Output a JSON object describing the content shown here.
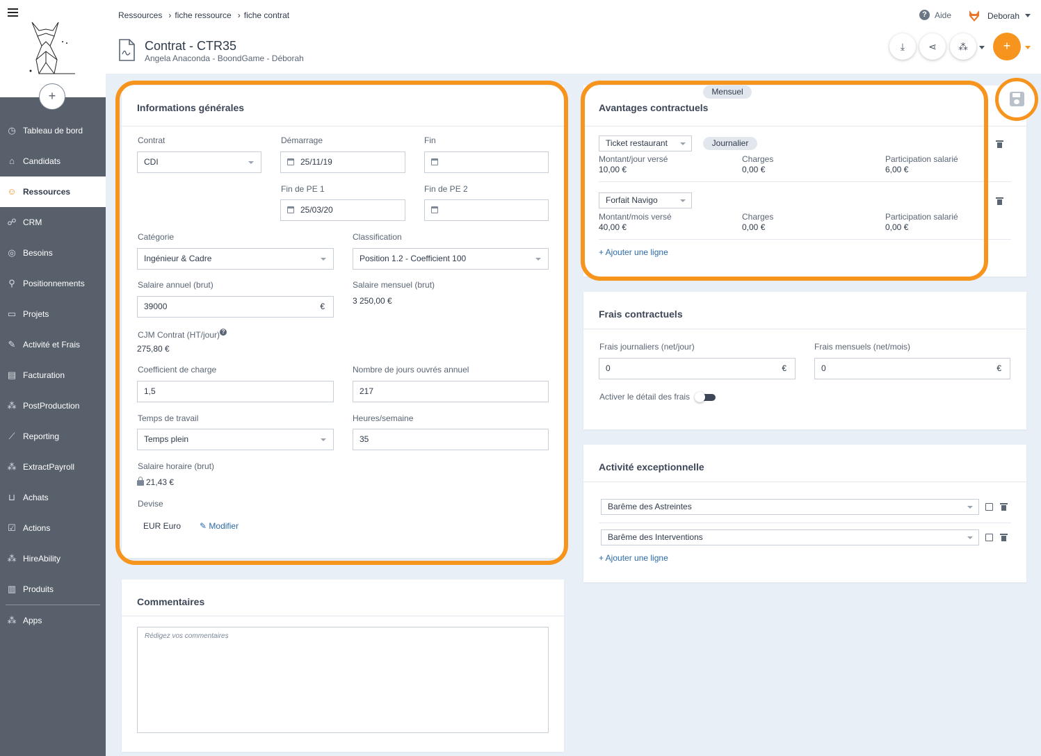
{
  "sidebar": {
    "items": [
      {
        "label": "Tableau de bord",
        "icon": "dashboard-icon"
      },
      {
        "label": "Candidats",
        "icon": "graduation-cap-icon"
      },
      {
        "label": "Ressources",
        "icon": "people-icon",
        "active": true
      },
      {
        "label": "CRM",
        "icon": "sitemap-icon"
      },
      {
        "label": "Besoins",
        "icon": "target-icon"
      },
      {
        "label": "Positionnements",
        "icon": "pin-icon"
      },
      {
        "label": "Projets",
        "icon": "briefcase-icon"
      },
      {
        "label": "Activité et Frais",
        "icon": "edit-icon"
      },
      {
        "label": "Facturation",
        "icon": "invoice-icon"
      },
      {
        "label": "PostProduction",
        "icon": "cubes-icon"
      },
      {
        "label": "Reporting",
        "icon": "chart-icon"
      },
      {
        "label": "ExtractPayroll",
        "icon": "cubes-icon"
      },
      {
        "label": "Achats",
        "icon": "cart-icon"
      },
      {
        "label": "Actions",
        "icon": "checklist-icon"
      },
      {
        "label": "HireAbility",
        "icon": "cubes-icon"
      },
      {
        "label": "Produits",
        "icon": "book-icon"
      }
    ],
    "apps_label": "Apps"
  },
  "breadcrumb": [
    "Ressources",
    "fiche ressource",
    "fiche contrat"
  ],
  "header": {
    "title": "Contrat - CTR35",
    "subtitle": "Angela Anaconda - BoondGame - Déborah",
    "help_label": "Aide",
    "user_name": "Deborah"
  },
  "info_generales": {
    "title": "Informations générales",
    "contrat_label": "Contrat",
    "contrat_value": "CDI",
    "demarrage_label": "Démarrage",
    "demarrage_value": "25/11/19",
    "fin_label": "Fin",
    "fin_value": "",
    "fin_pe1_label": "Fin de PE 1",
    "fin_pe1_value": "25/03/20",
    "fin_pe2_label": "Fin de PE 2",
    "fin_pe2_value": "",
    "categorie_label": "Catégorie",
    "categorie_value": "Ingénieur & Cadre",
    "classification_label": "Classification",
    "classification_value": "Position 1.2 - Coefficient 100",
    "salaire_annuel_label": "Salaire annuel (brut)",
    "salaire_annuel_value": "39000",
    "currency": "€",
    "salaire_mensuel_label": "Salaire mensuel (brut)",
    "salaire_mensuel_value": "3 250,00 €",
    "cjm_label": "CJM Contrat (HT/jour)",
    "cjm_value": "275,80 €",
    "coef_label": "Coefficient de charge",
    "coef_value": "1,5",
    "jours_label": "Nombre de jours ouvrés annuel",
    "jours_value": "217",
    "temps_label": "Temps de travail",
    "temps_value": "Temps plein",
    "heures_label": "Heures/semaine",
    "heures_value": "35",
    "horaire_label": "Salaire horaire (brut)",
    "horaire_value": "21,43 €",
    "devise_label": "Devise",
    "devise_value": "EUR Euro",
    "modifier_label": "Modifier"
  },
  "commentaires": {
    "title": "Commentaires",
    "placeholder": "Rédigez vos commentaires"
  },
  "avantages": {
    "title": "Avantages contractuels",
    "rows": [
      {
        "type": "Ticket restaurant",
        "freq": "Journalier",
        "montant_label": "Montant/jour versé",
        "montant": "10,00 €",
        "charges_label": "Charges",
        "charges": "0,00 €",
        "part_label": "Participation salarié",
        "part": "6,00 €"
      },
      {
        "type": "Forfait Navigo",
        "freq": "Mensuel",
        "montant_label": "Montant/mois versé",
        "montant": "40,00 €",
        "charges_label": "Charges",
        "charges": "0,00 €",
        "part_label": "Participation salarié",
        "part": "0,00 €"
      }
    ],
    "add_label": "+ Ajouter une ligne"
  },
  "frais": {
    "title": "Frais contractuels",
    "jour_label": "Frais journaliers (net/jour)",
    "jour_value": "0",
    "mois_label": "Frais mensuels (net/mois)",
    "mois_value": "0",
    "detail_label": "Activer le détail des frais"
  },
  "activite": {
    "title": "Activité exceptionnelle",
    "rows": [
      "Barême des Astreintes",
      "Barême des Interventions"
    ],
    "add_label": "+ Ajouter une ligne"
  },
  "colors": {
    "accent": "#f7941d",
    "sidebar": "#58606b",
    "link": "#2a6aa8"
  }
}
